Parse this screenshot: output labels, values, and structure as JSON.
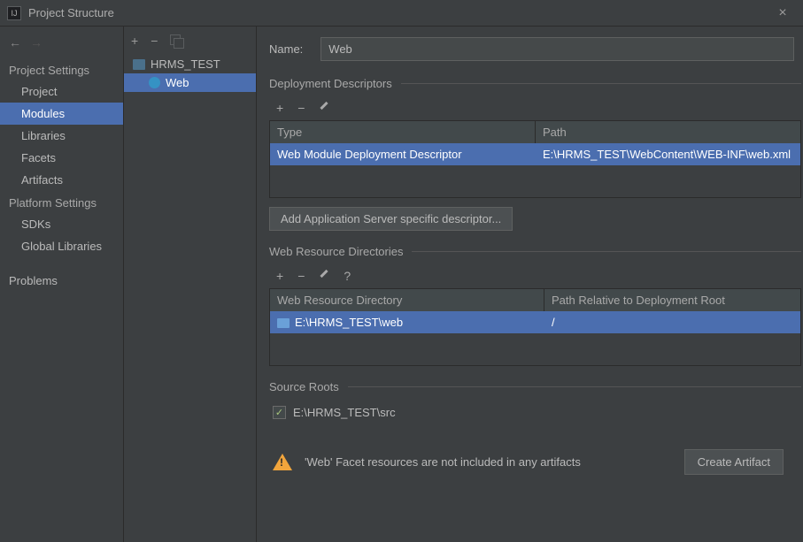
{
  "window": {
    "title": "Project Structure",
    "close_glyph": "×"
  },
  "toolbar": {
    "plus": "+",
    "minus": "−",
    "pencil_name": "edit-icon",
    "question": "?"
  },
  "nav": {
    "back_glyph": "←",
    "fwd_glyph": "→",
    "project_settings": "Project Settings",
    "platform_settings": "Platform Settings",
    "items": {
      "project": "Project",
      "modules": "Modules",
      "libraries": "Libraries",
      "facets": "Facets",
      "artifacts": "Artifacts",
      "sdks": "SDKs",
      "global_libraries": "Global Libraries",
      "problems": "Problems"
    }
  },
  "tree": {
    "root": "HRMS_TEST",
    "child": "Web"
  },
  "main": {
    "name_label": "Name:",
    "name_value": "Web",
    "descriptors": {
      "title": "Deployment Descriptors",
      "col_type": "Type",
      "col_path": "Path",
      "row_type": "Web Module Deployment Descriptor",
      "row_path": "E:\\HRMS_TEST\\WebContent\\WEB-INF\\web.xml",
      "add_btn": "Add Application Server specific descriptor..."
    },
    "resources": {
      "title": "Web Resource Directories",
      "col_dir": "Web Resource Directory",
      "col_rel": "Path Relative to Deployment Root",
      "row_dir": "E:\\HRMS_TEST\\web",
      "row_rel": "/"
    },
    "source_roots": {
      "title": "Source Roots",
      "item": "E:\\HRMS_TEST\\src",
      "checked_glyph": "✓"
    },
    "warning": {
      "text": "'Web' Facet resources are not included in any artifacts",
      "button": "Create Artifact"
    }
  }
}
